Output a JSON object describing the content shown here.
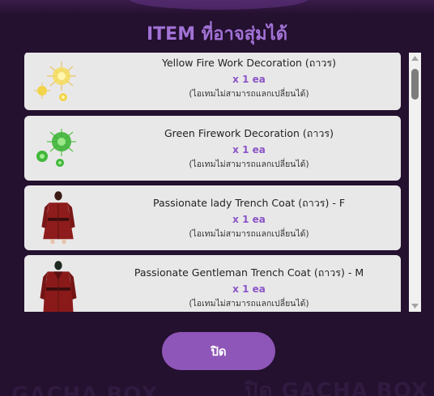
{
  "modal": {
    "title": "ITEM ที่อาจสุ่มได้",
    "close_label": "ปิด"
  },
  "background": {
    "ghost_text_left": "GACHA BOX",
    "ghost_text_right": "ปิด GACHA BOX"
  },
  "items": [
    {
      "name": "Yellow Fire Work Decoration (ถาวร)",
      "qty": "x 1 ea",
      "note": "(ไอเทมไม่สามารถแลกเปลี่ยนได้)",
      "icon": "yellow-firework-icon"
    },
    {
      "name": "Green Firework Decoration (ถาวร)",
      "qty": "x 1 ea",
      "note": "(ไอเทมไม่สามารถแลกเปลี่ยนได้)",
      "icon": "green-firework-icon"
    },
    {
      "name": "Passionate lady Trench Coat (ถาวร) - F",
      "qty": "x 1 ea",
      "note": "(ไอเทมไม่สามารถแลกเปลี่ยนได้)",
      "icon": "lady-trench-coat-icon"
    },
    {
      "name": "Passionate Gentleman Trench Coat (ถาวร) - M",
      "qty": "x 1 ea",
      "note": "(ไอเทมไม่สามารถแลกเปลี่ยนได้)",
      "icon": "gentleman-trench-coat-icon"
    }
  ],
  "colors": {
    "background": "#24102f",
    "title": "#a173d6",
    "card": "#e9e8e9",
    "qty": "#8a55c6",
    "button": "#8e56b8"
  }
}
